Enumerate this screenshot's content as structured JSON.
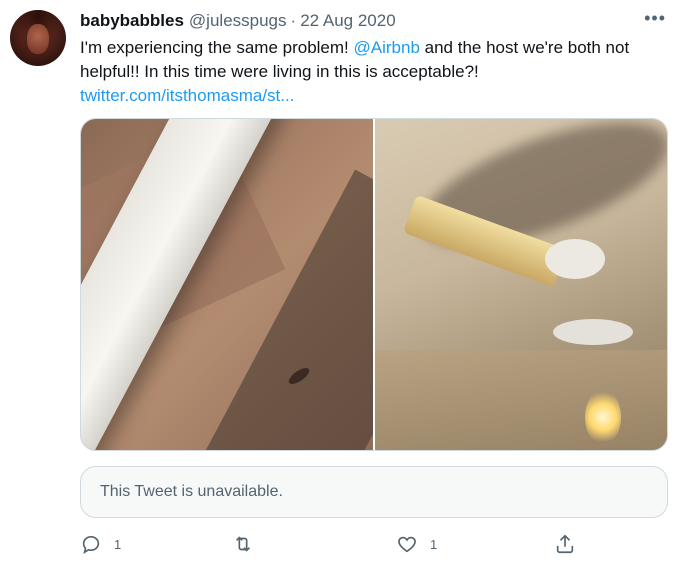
{
  "tweet": {
    "author_name": "babybabbles",
    "handle": "@julesspugs",
    "separator": "·",
    "date": "22 Aug 2020",
    "more_label": "•••",
    "text_before_mention": "I'm experiencing the same problem! ",
    "mention": "@Airbnb",
    "text_after_mention": " and the host we're both not helpful!! In this time were living in this is acceptable?!",
    "link": "twitter.com/itsthomasma/st..."
  },
  "quoted_tweet": {
    "text": "This Tweet is unavailable."
  },
  "actions": {
    "reply_count": "1",
    "retweet_count": "",
    "like_count": "1"
  },
  "icons": {
    "reply": "reply-icon",
    "retweet": "retweet-icon",
    "like": "heart-icon",
    "share": "share-icon"
  },
  "colors": {
    "link": "#1d9bf0",
    "secondary_text": "#536471",
    "primary_text": "#0f1419"
  }
}
